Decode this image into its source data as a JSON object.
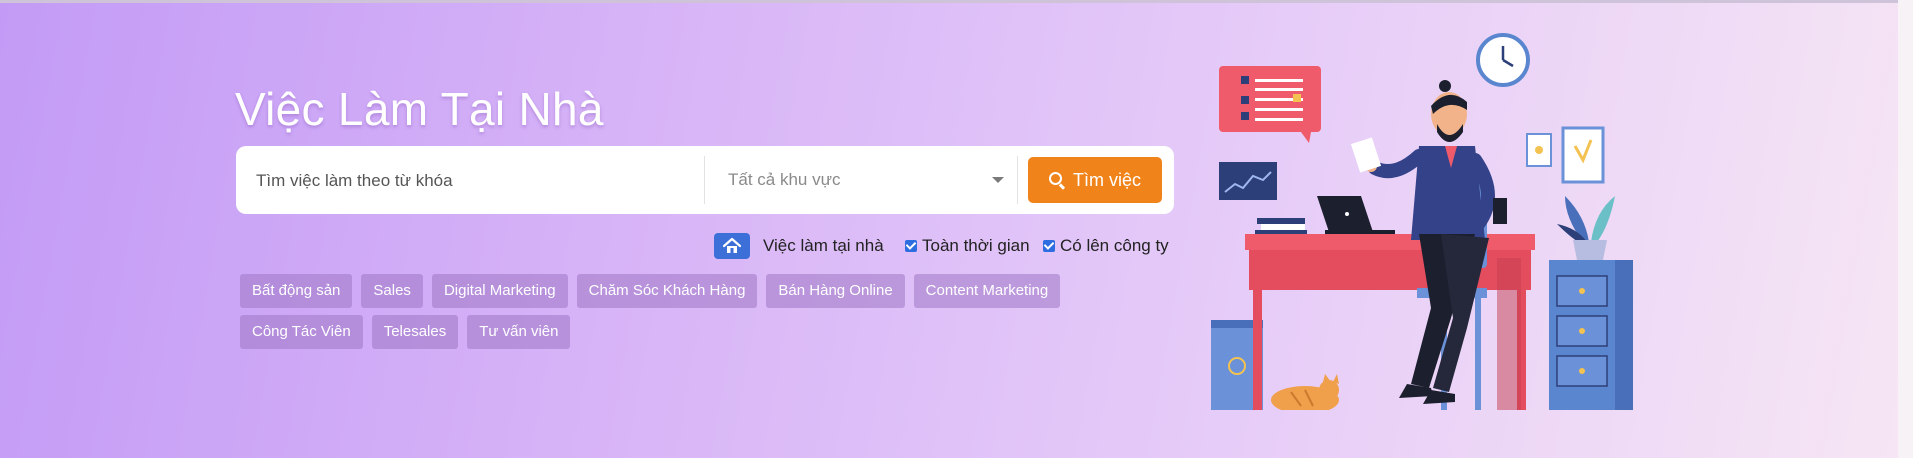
{
  "page": {
    "title": "Việc Làm Tại Nhà"
  },
  "search": {
    "keyword_placeholder": "Tìm việc làm theo từ khóa",
    "area_selected": "Tất cả khu vực",
    "button_label": "Tìm việc"
  },
  "filters": {
    "home_label": "Việc làm tại nhà",
    "fulltime_label": "Toàn thời gian",
    "office_label": "Có lên công ty"
  },
  "tags": {
    "row1": [
      "Bất động sản",
      "Sales",
      "Digital Marketing",
      "Chăm Sóc Khách Hàng",
      "Bán Hàng Online",
      "Content Marketing"
    ],
    "row2": [
      "Công Tác Viên",
      "Telesales",
      "Tư vấn viên"
    ]
  },
  "colors": {
    "accent_button": "#f08319",
    "checkbox": "#2e6de0",
    "background_start": "#c39bf6",
    "background_end": "#f6e6f4"
  },
  "icons": [
    "search-icon",
    "home-icon",
    "chevron-down-icon"
  ]
}
